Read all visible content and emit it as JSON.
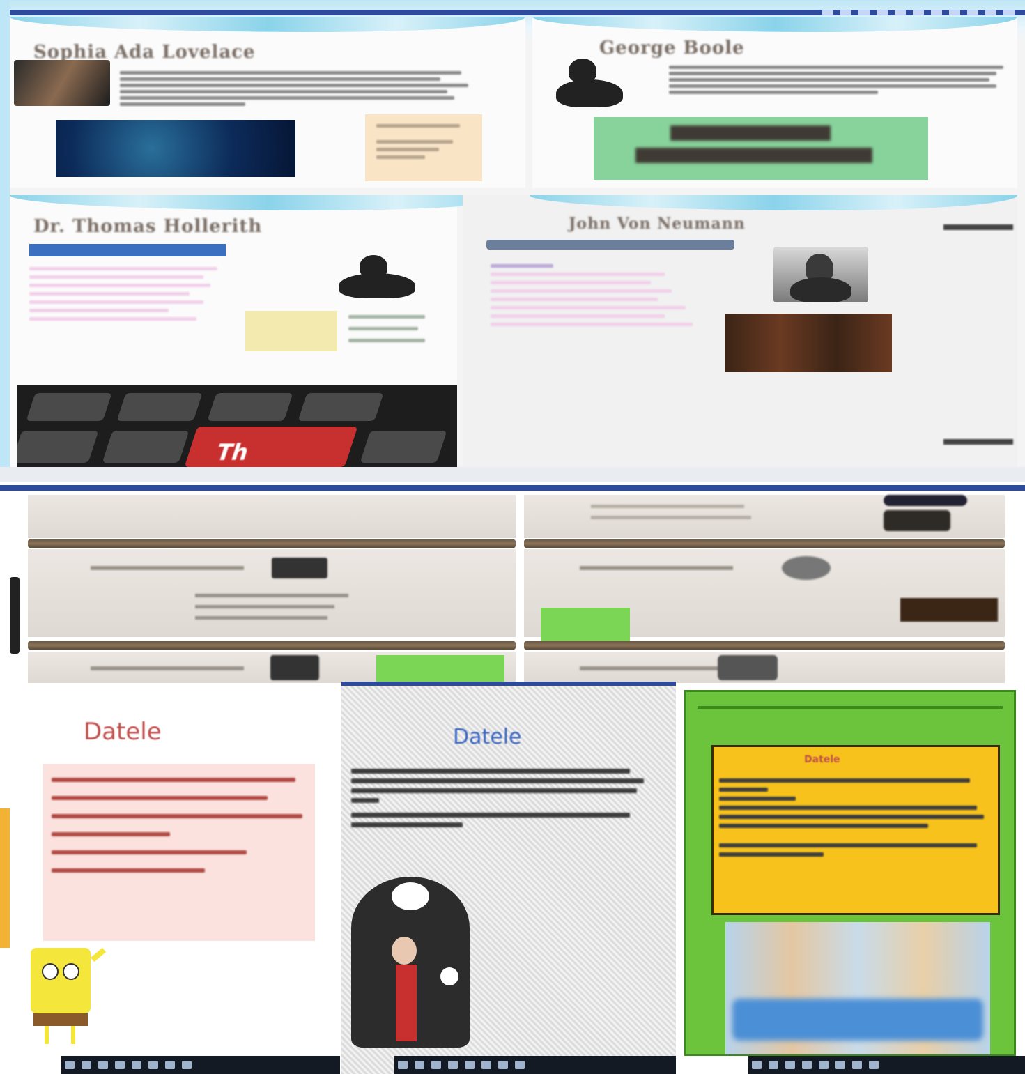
{
  "top": {
    "slides": [
      {
        "title": "Sophia Ada Lovelace"
      },
      {
        "title": "George Boole"
      },
      {
        "title": "Dr. Thomas Hollerith"
      },
      {
        "title": "John Von Neumann"
      }
    ],
    "keyboard_key_text": "Th"
  },
  "bottom": {
    "left_title": "Datele",
    "middle_title": "Datele",
    "right_title": "Datele"
  },
  "colors": {
    "titlebar": "#2e4a9a",
    "green_frame": "#6cc33c",
    "yellow_box": "#f7c21b",
    "taskbar": "#141a24",
    "red_title": "#c0504d",
    "blue_title": "#3a66c4"
  }
}
